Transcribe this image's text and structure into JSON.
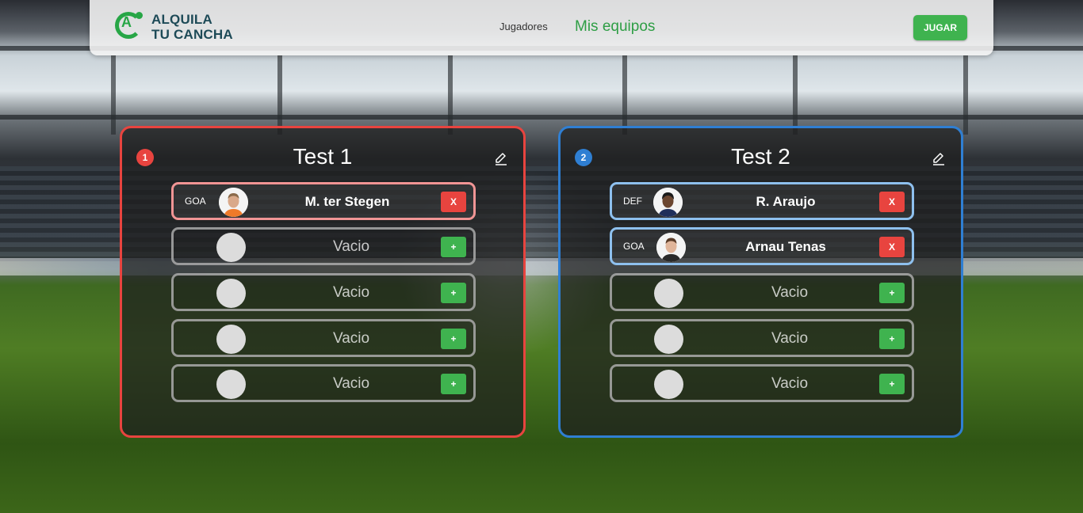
{
  "brand": {
    "line1": "ALQUILA",
    "line2": "TU CANCHA",
    "mark_letter": "A"
  },
  "nav": {
    "link_players": "Jugadores",
    "link_my_teams": "Mis equipos",
    "play_button": "JUGAR"
  },
  "colors": {
    "accent_green": "#3fb34f",
    "team1": "#e8443f",
    "team2": "#2f7fd3",
    "danger": "#e8443f"
  },
  "teams": [
    {
      "number": "1",
      "name": "Test 1",
      "slots": [
        {
          "position": "GOA",
          "player": "M. ter Stegen",
          "action": "X",
          "avatar": "player-photo-ter-stegen"
        },
        {
          "empty_label": "Vacio",
          "action": "+"
        },
        {
          "empty_label": "Vacio",
          "action": "+"
        },
        {
          "empty_label": "Vacio",
          "action": "+"
        },
        {
          "empty_label": "Vacio",
          "action": "+"
        }
      ]
    },
    {
      "number": "2",
      "name": "Test 2",
      "slots": [
        {
          "position": "DEF",
          "player": "R. Araujo",
          "action": "X",
          "avatar": "player-photo-araujo"
        },
        {
          "position": "GOA",
          "player": "Arnau Tenas",
          "action": "X",
          "avatar": "player-photo-tenas"
        },
        {
          "empty_label": "Vacio",
          "action": "+"
        },
        {
          "empty_label": "Vacio",
          "action": "+"
        },
        {
          "empty_label": "Vacio",
          "action": "+"
        }
      ]
    }
  ],
  "icons": {
    "edit": "pencil-icon",
    "logo": "logo-mark-icon"
  }
}
